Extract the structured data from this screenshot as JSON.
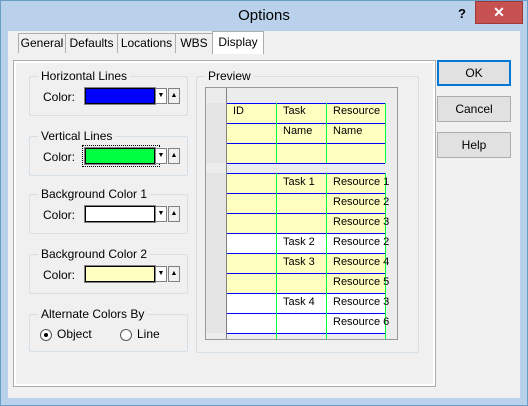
{
  "window": {
    "title": "Options",
    "help_glyph": "?",
    "close_glyph": "✕"
  },
  "tabs": [
    {
      "label": "General",
      "active": false
    },
    {
      "label": "Defaults",
      "active": false
    },
    {
      "label": "Locations",
      "active": false
    },
    {
      "label": "WBS",
      "active": false
    },
    {
      "label": "Display",
      "active": true
    }
  ],
  "groups": {
    "horizontal": {
      "title": "Horizontal Lines",
      "color_label": "Color:",
      "color": "#0000ff"
    },
    "vertical": {
      "title": "Vertical Lines",
      "color_label": "Color:",
      "color": "#00ff40"
    },
    "bg1": {
      "title": "Background Color 1",
      "color_label": "Color:",
      "color": "#ffffff"
    },
    "bg2": {
      "title": "Background Color 2",
      "color_label": "Color:",
      "color": "#ffffc0"
    },
    "alternate": {
      "title": "Alternate Colors By",
      "options": [
        "Object",
        "Line"
      ],
      "selected": "Object"
    }
  },
  "preview": {
    "title": "Preview",
    "header": {
      "col1": "ID",
      "col2_line1": "Task",
      "col2_line2": "Name",
      "col3_line1": "Resource",
      "col3_line2": "Name"
    },
    "rows": [
      {
        "task": "Task 1",
        "resource": "Resource 1",
        "bg": "bg2"
      },
      {
        "task": "",
        "resource": "Resource 2",
        "bg": "bg2"
      },
      {
        "task": "",
        "resource": "Resource 3",
        "bg": "bg2"
      },
      {
        "task": "Task 2",
        "resource": "Resource 2",
        "bg": "bg1"
      },
      {
        "task": "Task 3",
        "resource": "Resource 4",
        "bg": "bg2"
      },
      {
        "task": "",
        "resource": "Resource 5",
        "bg": "bg2"
      },
      {
        "task": "Task 4",
        "resource": "Resource 3",
        "bg": "bg1"
      },
      {
        "task": "",
        "resource": "Resource 6",
        "bg": "bg1"
      }
    ]
  },
  "buttons": {
    "ok": "OK",
    "cancel": "Cancel",
    "help": "Help"
  }
}
